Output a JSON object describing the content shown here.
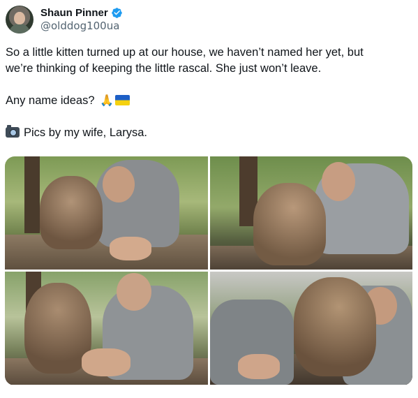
{
  "tweet": {
    "author": {
      "display_name": "Shaun Pinner",
      "handle": "@olddog100ua",
      "verified": true,
      "avatar_icon": "avatar-photo"
    },
    "text": {
      "line1": "So a little kitten turned up at our house, we haven’t named her yet, but",
      "line2": "we’re thinking of keeping the little rascal. She just won’t leave.",
      "question": "Any name ideas?",
      "question_emojis": [
        "folded-hands-icon",
        "ukraine-flag-icon"
      ],
      "credit_icon": "camera-icon",
      "credit": "Pics by my wife, Larysa."
    },
    "media": [
      {
        "name": "photo-kitten-1",
        "icon": "photo"
      },
      {
        "name": "photo-kitten-2",
        "icon": "photo"
      },
      {
        "name": "photo-kitten-3",
        "icon": "photo"
      },
      {
        "name": "photo-kitten-4",
        "icon": "photo"
      }
    ],
    "colors": {
      "text": "#0f1419",
      "secondary": "#536471",
      "verified": "#1d9bf0"
    }
  }
}
